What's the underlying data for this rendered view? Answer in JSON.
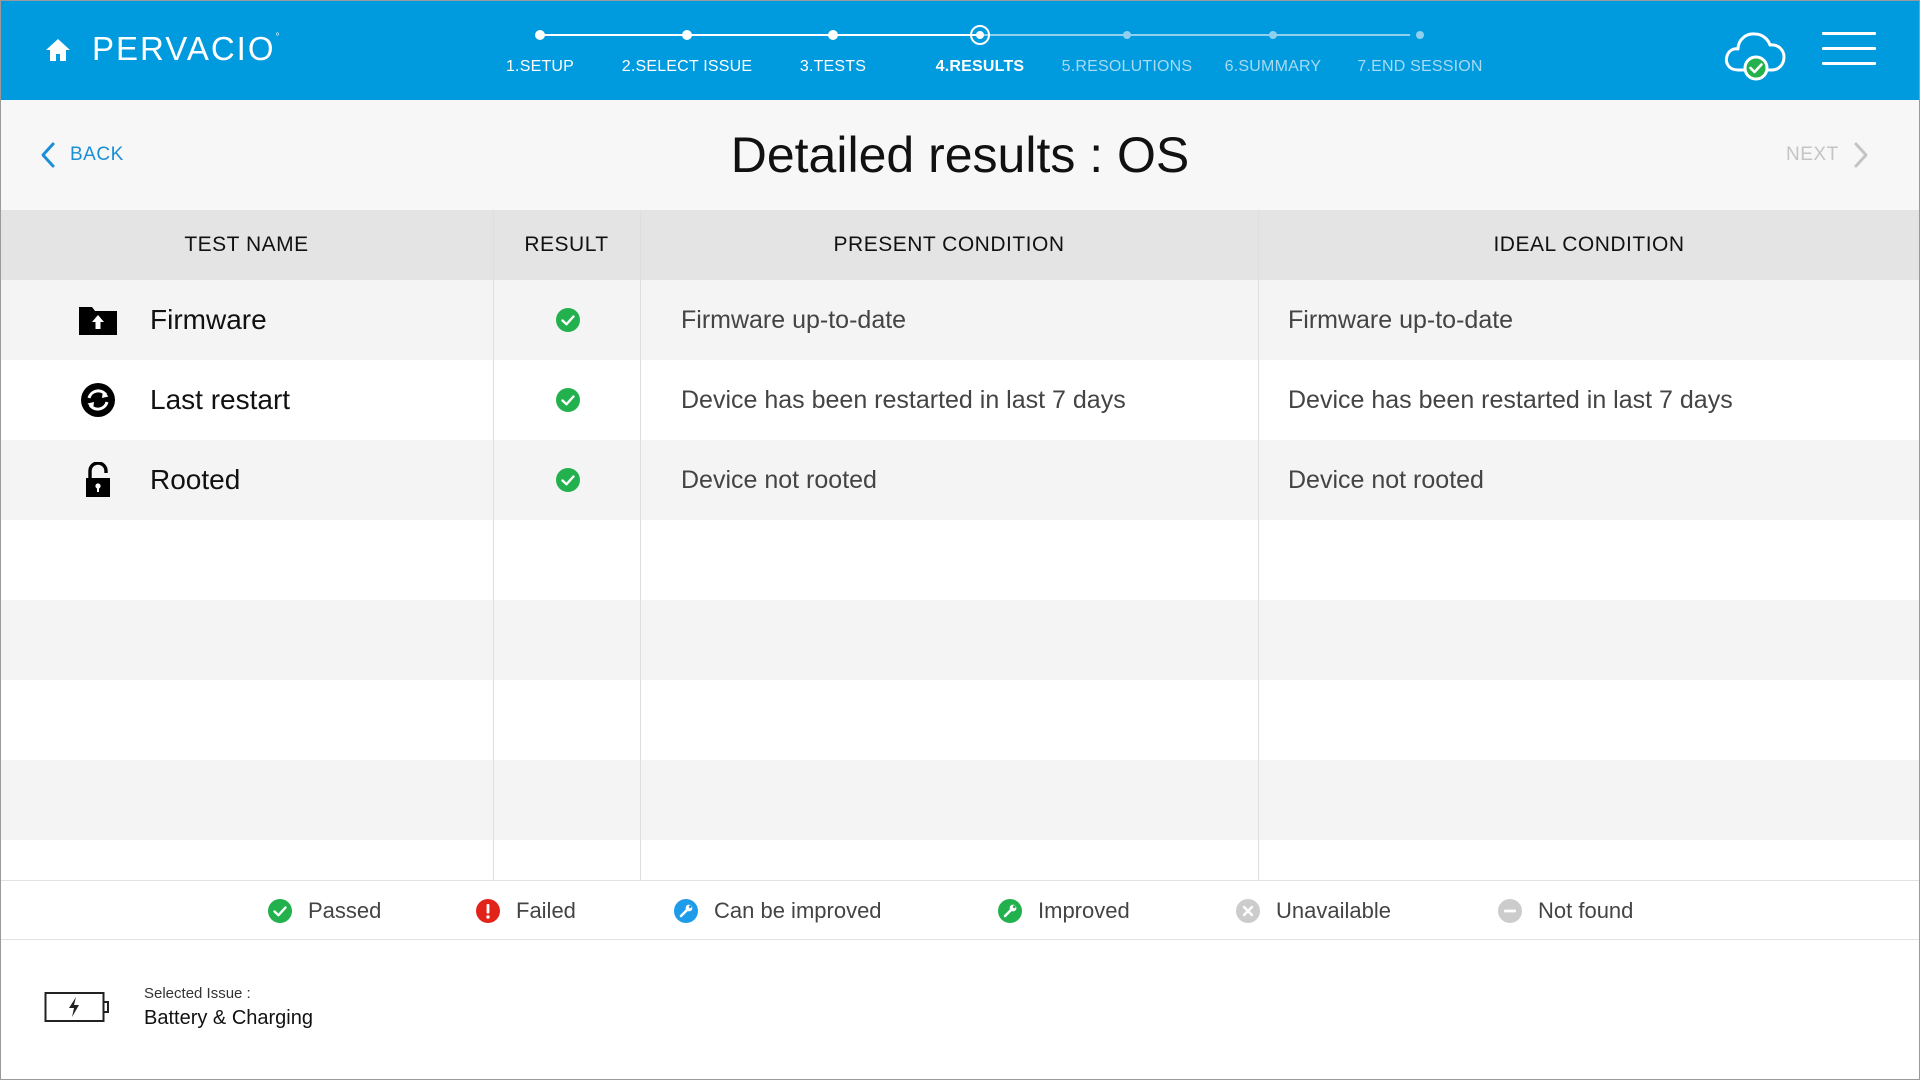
{
  "header": {
    "logo_text": "PERVACIO",
    "logo_mark": "°",
    "icons": {
      "home": "home-icon",
      "cloud": "cloud-check-icon",
      "menu": "hamburger-menu-icon"
    },
    "steps": [
      {
        "label": "1.SETUP",
        "state": "done"
      },
      {
        "label": "2.SELECT ISSUE",
        "state": "done"
      },
      {
        "label": "3.TESTS",
        "state": "done"
      },
      {
        "label": "4.RESULTS",
        "state": "current"
      },
      {
        "label": "5.RESOLUTIONS",
        "state": "future"
      },
      {
        "label": "6.SUMMARY",
        "state": "future"
      },
      {
        "label": "7.END SESSION",
        "state": "future"
      }
    ]
  },
  "titlebar": {
    "back_label": "BACK",
    "title": "Detailed results : OS",
    "next_label": "NEXT"
  },
  "table": {
    "headers": [
      "TEST NAME",
      "RESULT",
      "PRESENT CONDITION",
      "IDEAL CONDITION"
    ],
    "rows": [
      {
        "icon": "firmware-folder-icon",
        "name": "Firmware",
        "result": "Passed",
        "present": "Firmware up-to-date",
        "ideal": "Firmware up-to-date"
      },
      {
        "icon": "restart-icon",
        "name": "Last restart",
        "result": "Passed",
        "present": "Device has been restarted in last 7 days",
        "ideal": "Device has been restarted in last 7 days"
      },
      {
        "icon": "unlocked-padlock-icon",
        "name": "Rooted",
        "result": "Passed",
        "present": "Device not rooted",
        "ideal": "Device not rooted"
      }
    ]
  },
  "legend": [
    {
      "label": "Passed",
      "icon": "passed-icon",
      "color": "#22b14c"
    },
    {
      "label": "Failed",
      "icon": "failed-icon",
      "color": "#e2231a"
    },
    {
      "label": "Can be improved",
      "icon": "can-be-improved-icon",
      "color": "#1e9be9"
    },
    {
      "label": "Improved",
      "icon": "improved-icon",
      "color": "#22b14c"
    },
    {
      "label": "Unavailable",
      "icon": "unavailable-icon",
      "color": "#cccccc"
    },
    {
      "label": "Not found",
      "icon": "not-found-icon",
      "color": "#cccccc"
    }
  ],
  "footer": {
    "selected_issue_label": "Selected Issue :",
    "selected_issue_value": "Battery & Charging",
    "icon": "battery-charging-icon"
  },
  "colors": {
    "header_bg": "#009ade",
    "accent_link": "#1a8fd6",
    "passed": "#22b14c"
  }
}
